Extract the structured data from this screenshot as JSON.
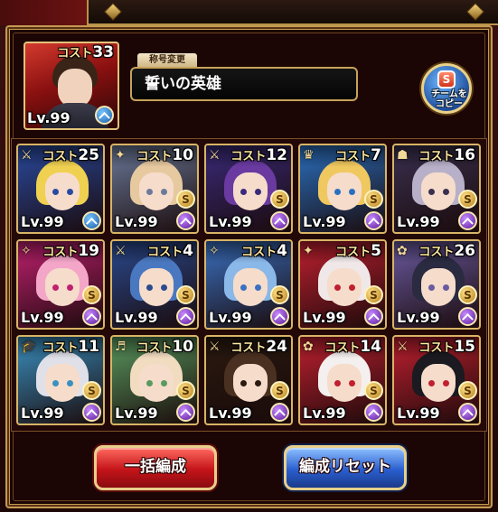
{
  "leader": {
    "cost_label": "コスト",
    "cost": "33",
    "level": "Lv.99"
  },
  "title_section": {
    "label": "称号変更",
    "value": "誓いの英雄"
  },
  "copy_button": {
    "line1": "チームを",
    "line2": "コピー"
  },
  "cost_label": "コスト",
  "units": [
    {
      "cost": "25",
      "level": "Lv.99",
      "awaken": "blue"
    },
    {
      "cost": "10",
      "level": "Lv.99",
      "awaken": "purple"
    },
    {
      "cost": "12",
      "level": "Lv.99",
      "awaken": "purple"
    },
    {
      "cost": "7",
      "level": "Lv.99",
      "awaken": "purple"
    },
    {
      "cost": "16",
      "level": "Lv.99",
      "awaken": "purple"
    },
    {
      "cost": "19",
      "level": "Lv.99",
      "awaken": "purple"
    },
    {
      "cost": "4",
      "level": "Lv.99",
      "awaken": "purple"
    },
    {
      "cost": "4",
      "level": "Lv.99",
      "awaken": "purple"
    },
    {
      "cost": "5",
      "level": "Lv.99",
      "awaken": "purple"
    },
    {
      "cost": "26",
      "level": "Lv.99",
      "awaken": "purple"
    },
    {
      "cost": "11",
      "level": "Lv.99",
      "awaken": "purple"
    },
    {
      "cost": "10",
      "level": "Lv.99",
      "awaken": "purple"
    },
    {
      "cost": "24",
      "level": "Lv.99",
      "awaken": "purple"
    },
    {
      "cost": "14",
      "level": "Lv.99",
      "awaken": "purple"
    },
    {
      "cost": "15",
      "level": "Lv.99",
      "awaken": "purple"
    }
  ],
  "buttons": {
    "auto_form": "一括編成",
    "reset": "編成リセット"
  },
  "colors": {
    "frame_gold": "#c39a52",
    "panel_bg": "#1b0505",
    "accent_red": "#c4141a",
    "accent_blue": "#2a5fd0"
  }
}
